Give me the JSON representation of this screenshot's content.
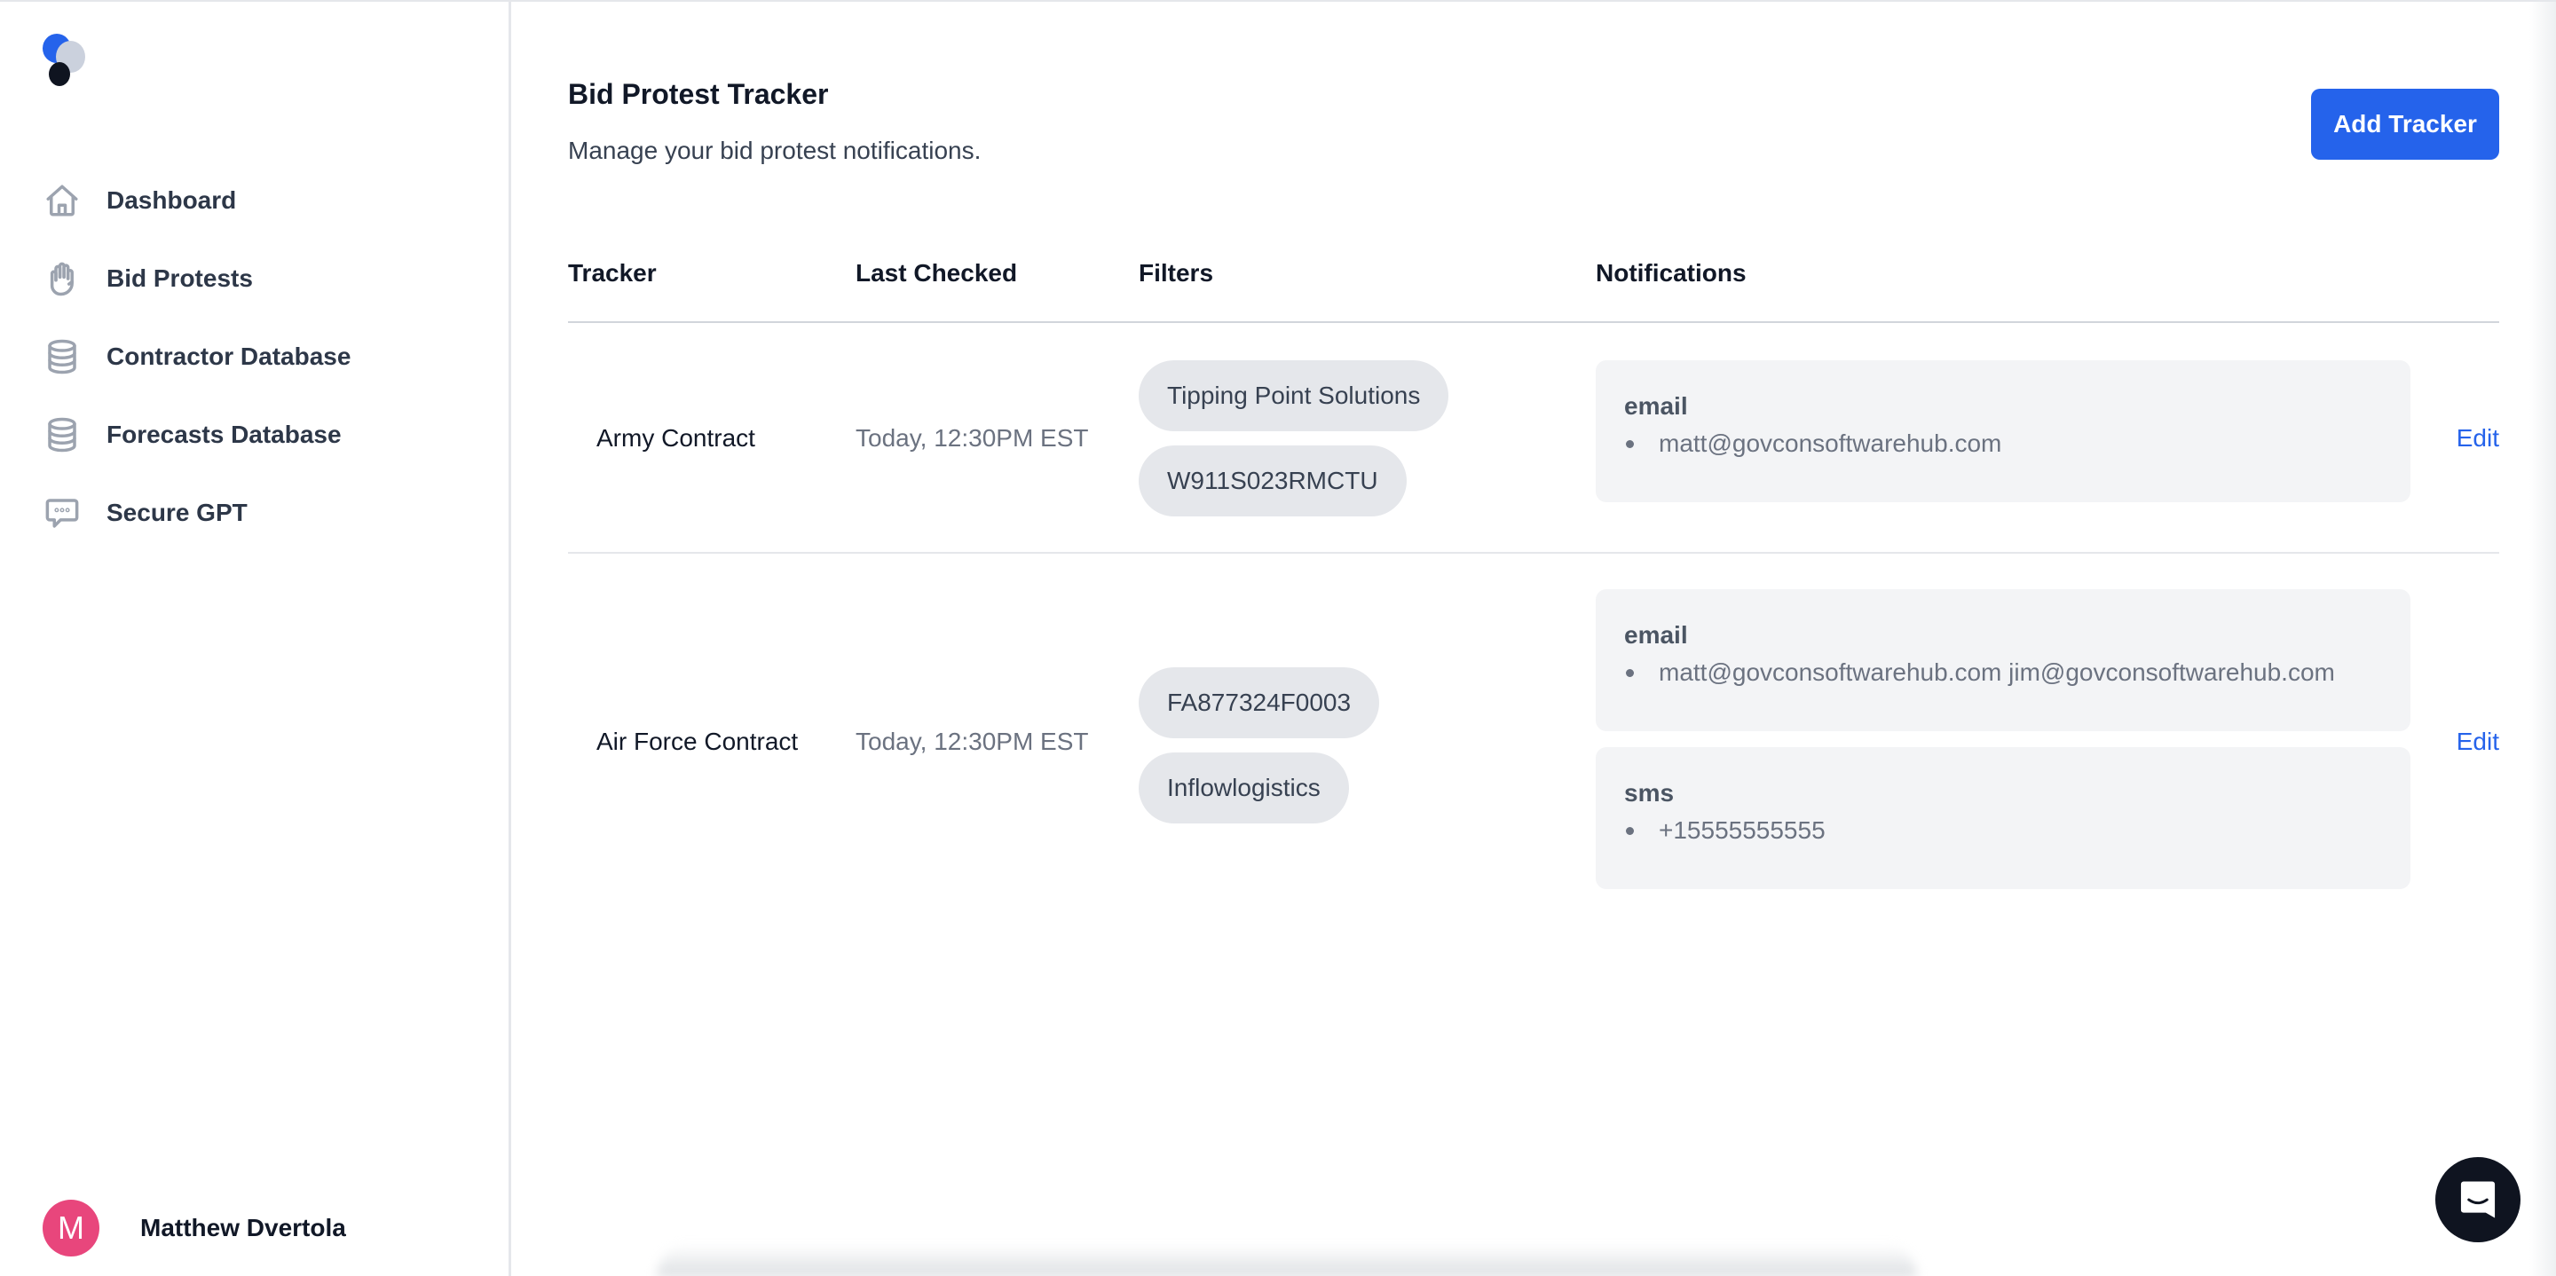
{
  "brand": {
    "logo_colors": [
      "#2563eb",
      "#cbd1dd",
      "#0f1420"
    ]
  },
  "sidebar": {
    "items": [
      {
        "label": "Dashboard",
        "icon": "home-icon"
      },
      {
        "label": "Bid Protests",
        "icon": "hand-icon"
      },
      {
        "label": "Contractor Database",
        "icon": "database-icon"
      },
      {
        "label": "Forecasts Database",
        "icon": "database-icon"
      },
      {
        "label": "Secure GPT",
        "icon": "chat-dots-icon"
      }
    ],
    "user": {
      "initial": "M",
      "name": "Matthew Dvertola",
      "avatar_color": "#e8467c"
    }
  },
  "header": {
    "title": "Bid Protest Tracker",
    "subtitle": "Manage your bid protest notifications.",
    "add_button": "Add Tracker"
  },
  "table": {
    "columns": [
      "Tracker",
      "Last Checked",
      "Filters",
      "Notifications"
    ],
    "rows": [
      {
        "tracker": "Army Contract",
        "last_checked": "Today, 12:30PM EST",
        "filters": [
          "Tipping Point Solutions",
          "W911S023RMCTU"
        ],
        "notifications": [
          {
            "type": "email",
            "items": [
              "matt@govconsoftwarehub.com"
            ]
          }
        ],
        "action": "Edit"
      },
      {
        "tracker": "Air Force Contract",
        "last_checked": "Today, 12:30PM EST",
        "filters": [
          "FA877324F0003",
          "Inflowlogistics"
        ],
        "notifications": [
          {
            "type": "email",
            "items": [
              "matt@govconsoftwarehub.com jim@govconsoftwarehub.com"
            ]
          },
          {
            "type": "sms",
            "items": [
              "+15555555555"
            ]
          }
        ],
        "action": "Edit"
      }
    ]
  },
  "colors": {
    "accent": "#2563eb",
    "chip_bg": "#e5e7eb",
    "notif_bg": "#f3f4f6"
  },
  "widgets": {
    "chat_launcher": "chat-launcher-icon"
  }
}
